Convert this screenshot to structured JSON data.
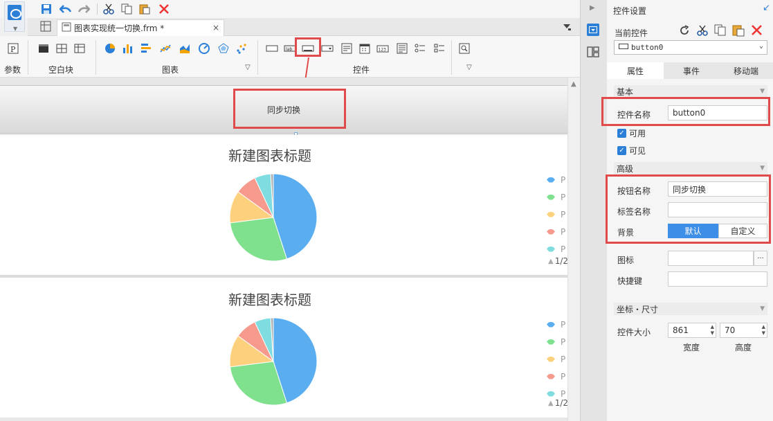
{
  "toolbar": {
    "save": "save-icon",
    "undo": "undo-icon",
    "redo": "redo-icon",
    "cut": "cut-icon",
    "copy": "copy-icon",
    "paste": "paste-icon",
    "delete": "delete-icon"
  },
  "tab": {
    "title": "图表实现统一切换.frm *",
    "close": "×"
  },
  "ribbon": {
    "groups": [
      "参数",
      "空白块",
      "图表",
      "控件"
    ]
  },
  "canvas": {
    "button_text": "同步切换",
    "charts": [
      {
        "title": "新建图表标题",
        "page": "1/2"
      },
      {
        "title": "新建图表标题",
        "page": "1/2"
      }
    ]
  },
  "chart_data": [
    {
      "type": "pie",
      "title": "新建图表标题",
      "legend": [
        "P",
        "P",
        "P",
        "P",
        "P"
      ],
      "values": [
        45,
        28,
        12,
        8,
        6,
        1
      ],
      "colors": [
        "#5aaef0",
        "#7fe08e",
        "#fdd07e",
        "#f59a8c",
        "#7fdde0",
        "#b0b0b0"
      ]
    },
    {
      "type": "pie",
      "title": "新建图表标题",
      "legend": [
        "P",
        "P",
        "P",
        "P",
        "P"
      ],
      "values": [
        45,
        28,
        12,
        8,
        6,
        1
      ],
      "colors": [
        "#5aaef0",
        "#7fe08e",
        "#fdd07e",
        "#f59a8c",
        "#7fdde0",
        "#b0b0b0"
      ]
    }
  ],
  "panel": {
    "title": "控件设置",
    "current_label": "当前控件",
    "current_value": "button0",
    "tabs": [
      "属性",
      "事件",
      "移动端"
    ],
    "basic": "基本",
    "name_label": "控件名称",
    "name_value": "button0",
    "enabled": "可用",
    "visible": "可见",
    "advanced": "高级",
    "button_name_label": "按钮名称",
    "button_name_value": "同步切换",
    "tag_name_label": "标签名称",
    "tag_name_value": "",
    "bg_label": "背景",
    "bg_default": "默认",
    "bg_custom": "自定义",
    "icon_label": "图标",
    "icon_more": "···",
    "shortcut_label": "快捷键",
    "size_section": "坐标・尺寸",
    "size_label": "控件大小",
    "width_value": "861",
    "height_value": "70",
    "width_label": "宽度",
    "height_label": "高度"
  },
  "colors": {
    "accent": "#2b7fd6",
    "highlight": "#e14a4a",
    "default_btn": "#3d8ee6"
  }
}
